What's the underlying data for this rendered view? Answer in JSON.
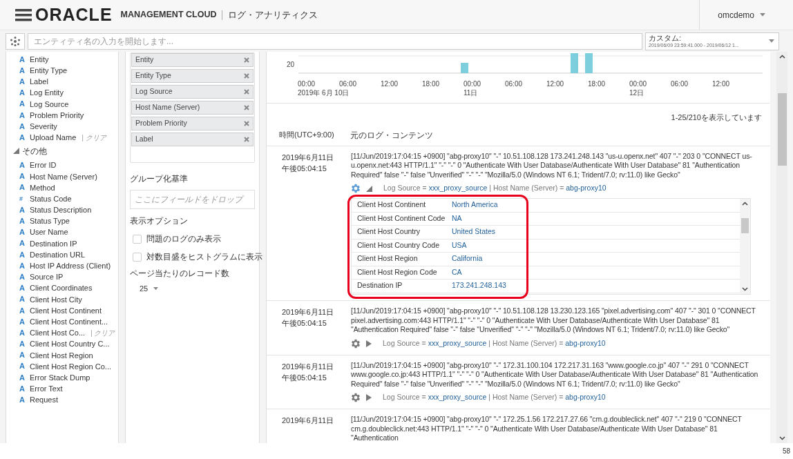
{
  "header": {
    "logo": "ORACLE",
    "product": "MANAGEMENT CLOUD",
    "app_title": "ログ・アナリティクス",
    "user": "omcdemo"
  },
  "search": {
    "placeholder": "エンティティ名の入力を開始します..."
  },
  "time_range": {
    "label": "カスタム:",
    "value": "2019/06/09 23:59:41.000 - 2019/06/12 1..."
  },
  "field_list": {
    "items": [
      {
        "kind": "text",
        "icon": "A",
        "label": "Entity"
      },
      {
        "kind": "text",
        "icon": "A",
        "label": "Entity Type"
      },
      {
        "kind": "text",
        "icon": "A",
        "label": "Label"
      },
      {
        "kind": "text",
        "icon": "A",
        "label": "Log Entity"
      },
      {
        "kind": "text",
        "icon": "A",
        "label": "Log Source"
      },
      {
        "kind": "text",
        "icon": "A",
        "label": "Problem Priority"
      },
      {
        "kind": "text",
        "icon": "A",
        "label": "Severity"
      },
      {
        "kind": "text",
        "icon": "A",
        "label": "Upload Name",
        "clear": "| クリア"
      }
    ],
    "groups": [
      {
        "label": "その他",
        "expanded": true,
        "children": [
          {
            "kind": "text",
            "icon": "A",
            "label": "Error ID"
          },
          {
            "kind": "text",
            "icon": "A",
            "label": "Host Name (Server)"
          },
          {
            "kind": "text",
            "icon": "A",
            "label": "Method"
          },
          {
            "kind": "number",
            "icon": "#",
            "label": "Status Code"
          },
          {
            "kind": "text",
            "icon": "A",
            "label": "Status Description"
          },
          {
            "kind": "text",
            "icon": "A",
            "label": "Status Type"
          },
          {
            "kind": "text",
            "icon": "A",
            "label": "User Name"
          },
          {
            "kind": "text",
            "icon": "A",
            "label": "Destination IP"
          },
          {
            "kind": "text",
            "icon": "A",
            "label": "Destination URL"
          },
          {
            "kind": "text",
            "icon": "A",
            "label": "Host IP Address (Client)"
          },
          {
            "kind": "text",
            "icon": "A",
            "label": "Source IP"
          },
          {
            "kind": "text",
            "icon": "A",
            "label": "Client Coordinates"
          },
          {
            "kind": "text",
            "icon": "A",
            "label": "Client Host City"
          },
          {
            "kind": "text",
            "icon": "A",
            "label": "Client Host Continent"
          },
          {
            "kind": "text",
            "icon": "A",
            "label": "Client Host Continent..."
          },
          {
            "kind": "text",
            "icon": "A",
            "label": "Client Host Co...",
            "clear": "| クリア"
          },
          {
            "kind": "text",
            "icon": "A",
            "label": "Client Host Country C..."
          },
          {
            "kind": "text",
            "icon": "A",
            "label": "Client Host Region"
          },
          {
            "kind": "text",
            "icon": "A",
            "label": "Client Host Region Co..."
          },
          {
            "kind": "text",
            "icon": "A",
            "label": "Error Stack Dump"
          },
          {
            "kind": "text",
            "icon": "A",
            "label": "Error Text"
          },
          {
            "kind": "text",
            "icon": "A",
            "label": "Request"
          }
        ]
      }
    ]
  },
  "display_fields": [
    "Entity",
    "Entity Type",
    "Log Source",
    "Host Name (Server)",
    "Problem Priority",
    "Label"
  ],
  "group_by": {
    "title": "グループ化基準",
    "placeholder": "ここにフィールドをドロップ"
  },
  "display_options": {
    "title": "表示オプション",
    "options": [
      {
        "label": "問題のログのみ表示",
        "checked": false
      },
      {
        "label": "対数目盛をヒストグラムに表示",
        "checked": false
      }
    ],
    "records_label": "ページ当たりのレコード数",
    "records_value": "25"
  },
  "histogram": {
    "ytick": "20",
    "ticks": [
      {
        "time": "00:00",
        "date": "2019年 6月 10日"
      },
      {
        "time": "06:00"
      },
      {
        "time": "12:00"
      },
      {
        "time": "18:00"
      },
      {
        "time": "00:00",
        "date": "11日"
      },
      {
        "time": "06:00"
      },
      {
        "time": "12:00"
      },
      {
        "time": "18:00"
      },
      {
        "time": "00:00",
        "date": "12日"
      },
      {
        "time": "06:00"
      },
      {
        "time": "12:00"
      }
    ]
  },
  "results": {
    "count": "1-25/210を表示しています",
    "columns": [
      "時間(UTC+9:00)",
      "元のログ・コンテンツ"
    ],
    "field_separator": "|",
    "rows": [
      {
        "date": "2019年6月11日",
        "time": "午後05:04:15",
        "text": "[11/Jun/2019:17:04:15 +0900] \"abg-proxy10\" \"-\" 10.51.108.128 173.241.248.143 \"us-u.openx.net\" 407 \"-\" 203 0 \"CONNECT us-u.openx.net:443 HTTP/1.1\" \"-\" \"-\" 0 \"Authenticate With User Database/Authenticate With User Database\" 81 \"Authentication Required\" false \"-\" false \"Unverified\" \"-\" \"-\" \"Mozilla/5.0 (Windows NT 6.1; Trident/7.0; rv:11.0) like Gecko\"",
        "expanded": true,
        "fields": [
          {
            "name": "Log Source =",
            "value": "xxx_proxy_source"
          },
          {
            "name": "Host Name (Server) =",
            "value": "abg-proxy10"
          }
        ],
        "details": [
          {
            "name": "Client Host Continent",
            "value": "North America"
          },
          {
            "name": "Client Host Continent Code",
            "value": "NA"
          },
          {
            "name": "Client Host Country",
            "value": "United States"
          },
          {
            "name": "Client Host Country Code",
            "value": "USA"
          },
          {
            "name": "Client Host Region",
            "value": "California"
          },
          {
            "name": "Client Host Region Code",
            "value": "CA"
          },
          {
            "name": "Destination IP",
            "value": "173.241.248.143"
          }
        ]
      },
      {
        "date": "2019年6月11日",
        "time": "午後05:04:15",
        "text": "[11/Jun/2019:17:04:15 +0900] \"abg-proxy10\" \"-\" 10.51.108.128 13.230.123.165 \"pixel.advertising.com\" 407 \"-\" 301 0 \"CONNECT pixel.advertising.com:443 HTTP/1.1\" \"-\" \"-\" 0 \"Authenticate With User Database/Authenticate With User Database\" 81 \"Authentication Required\" false \"-\" false \"Unverified\" \"-\" \"-\" \"Mozilla/5.0 (Windows NT 6.1; Trident/7.0; rv:11.0) like Gecko\"",
        "expanded": false,
        "fields": [
          {
            "name": "Log Source =",
            "value": "xxx_proxy_source"
          },
          {
            "name": "Host Name (Server) =",
            "value": "abg-proxy10"
          }
        ]
      },
      {
        "date": "2019年6月11日",
        "time": "午後05:04:15",
        "text": "[11/Jun/2019:17:04:15 +0900] \"abg-proxy10\" \"-\" 172.31.100.104 172.217.31.163 \"www.google.co.jp\" 407 \"-\" 291 0 \"CONNECT www.google.co.jp:443 HTTP/1.1\" \"-\" \"-\" 0 \"Authenticate With User Database/Authenticate With User Database\" 81 \"Authentication Required\" false \"-\" false \"Unverified\" \"-\" \"-\" \"Mozilla/5.0 (Windows NT 6.1; Trident/7.0; rv:11.0) like Gecko\"",
        "expanded": false,
        "fields": [
          {
            "name": "Log Source =",
            "value": "xxx_proxy_source"
          },
          {
            "name": "Host Name (Server) =",
            "value": "abg-proxy10"
          }
        ]
      },
      {
        "date": "2019年6月11日",
        "text": "[11/Jun/2019:17:04:15 +0900] \"abg-proxy10\" \"-\" 172.25.1.56 172.217.27.66 \"cm.g.doubleclick.net\" 407 \"-\" 219 0 \"CONNECT cm.g.doubleclick.net:443 HTTP/1.1\" \"-\" \"-\" 0 \"Authenticate With User Database/Authenticate With User Database\" 81 \"Authentication"
      }
    ]
  },
  "page_number": "58"
}
